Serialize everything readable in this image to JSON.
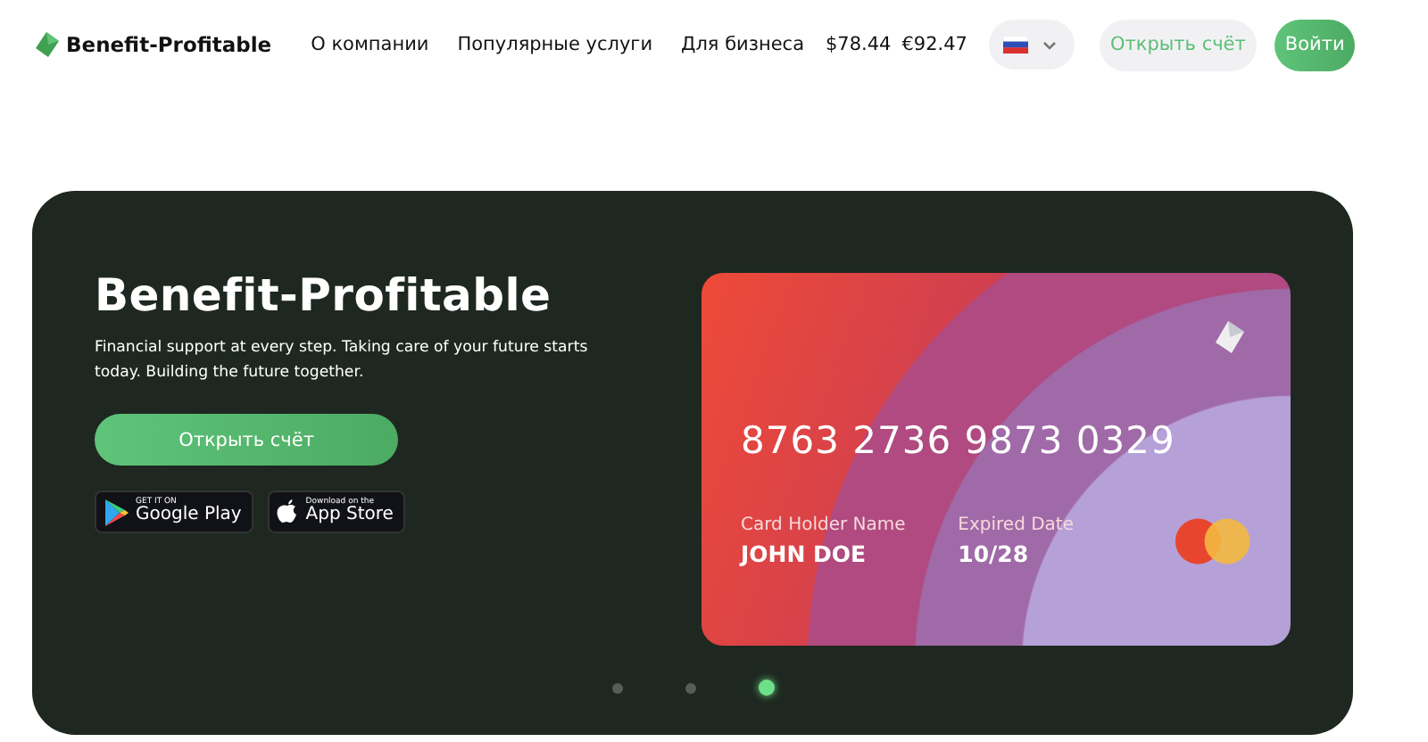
{
  "header": {
    "logo": "Benefit-Profitable",
    "nav": [
      {
        "label": "О компании"
      },
      {
        "label": "Популярные услуги"
      },
      {
        "label": "Для бизнеса"
      }
    ],
    "rates": [
      "$78.44",
      "€92.47"
    ],
    "open_account": "Открыть счёт",
    "login": "Войти"
  },
  "hero": {
    "title": "Benefit-Profitable",
    "description": "Financial support at every step. Taking care of your future starts today. Building the future together.",
    "cta": "Открыть счёт",
    "store_badges": [
      {
        "kind": "google",
        "small": "GET IT ON",
        "big": "Google Play"
      },
      {
        "kind": "apple",
        "small": "Download on the",
        "big": "App Store"
      }
    ],
    "card": {
      "number": "8763 2736 9873 0329",
      "holder_label": "Card Holder Name",
      "holder": "JOHN DOE",
      "expiry_label": "Expired Date",
      "expiry": "10/28"
    },
    "slides": [
      {
        "selected": false
      },
      {
        "selected": false
      },
      {
        "selected": true
      }
    ]
  }
}
